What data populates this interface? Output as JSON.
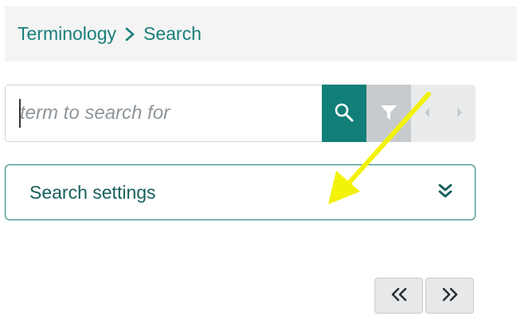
{
  "breadcrumb": {
    "root": "Terminology",
    "current": "Search"
  },
  "search": {
    "placeholder": "term to search for",
    "value": ""
  },
  "icons": {
    "search": "search-icon",
    "filter": "filter-icon",
    "prev": "caret-left-icon",
    "next": "caret-right-icon",
    "expand": "double-chevron-down-icon",
    "first_page": "double-chevron-left-icon",
    "last_page": "double-chevron-right-icon"
  },
  "settings": {
    "label": "Search settings"
  },
  "colors": {
    "accent": "#117f78",
    "annotation_arrow": "#f2f20a"
  }
}
